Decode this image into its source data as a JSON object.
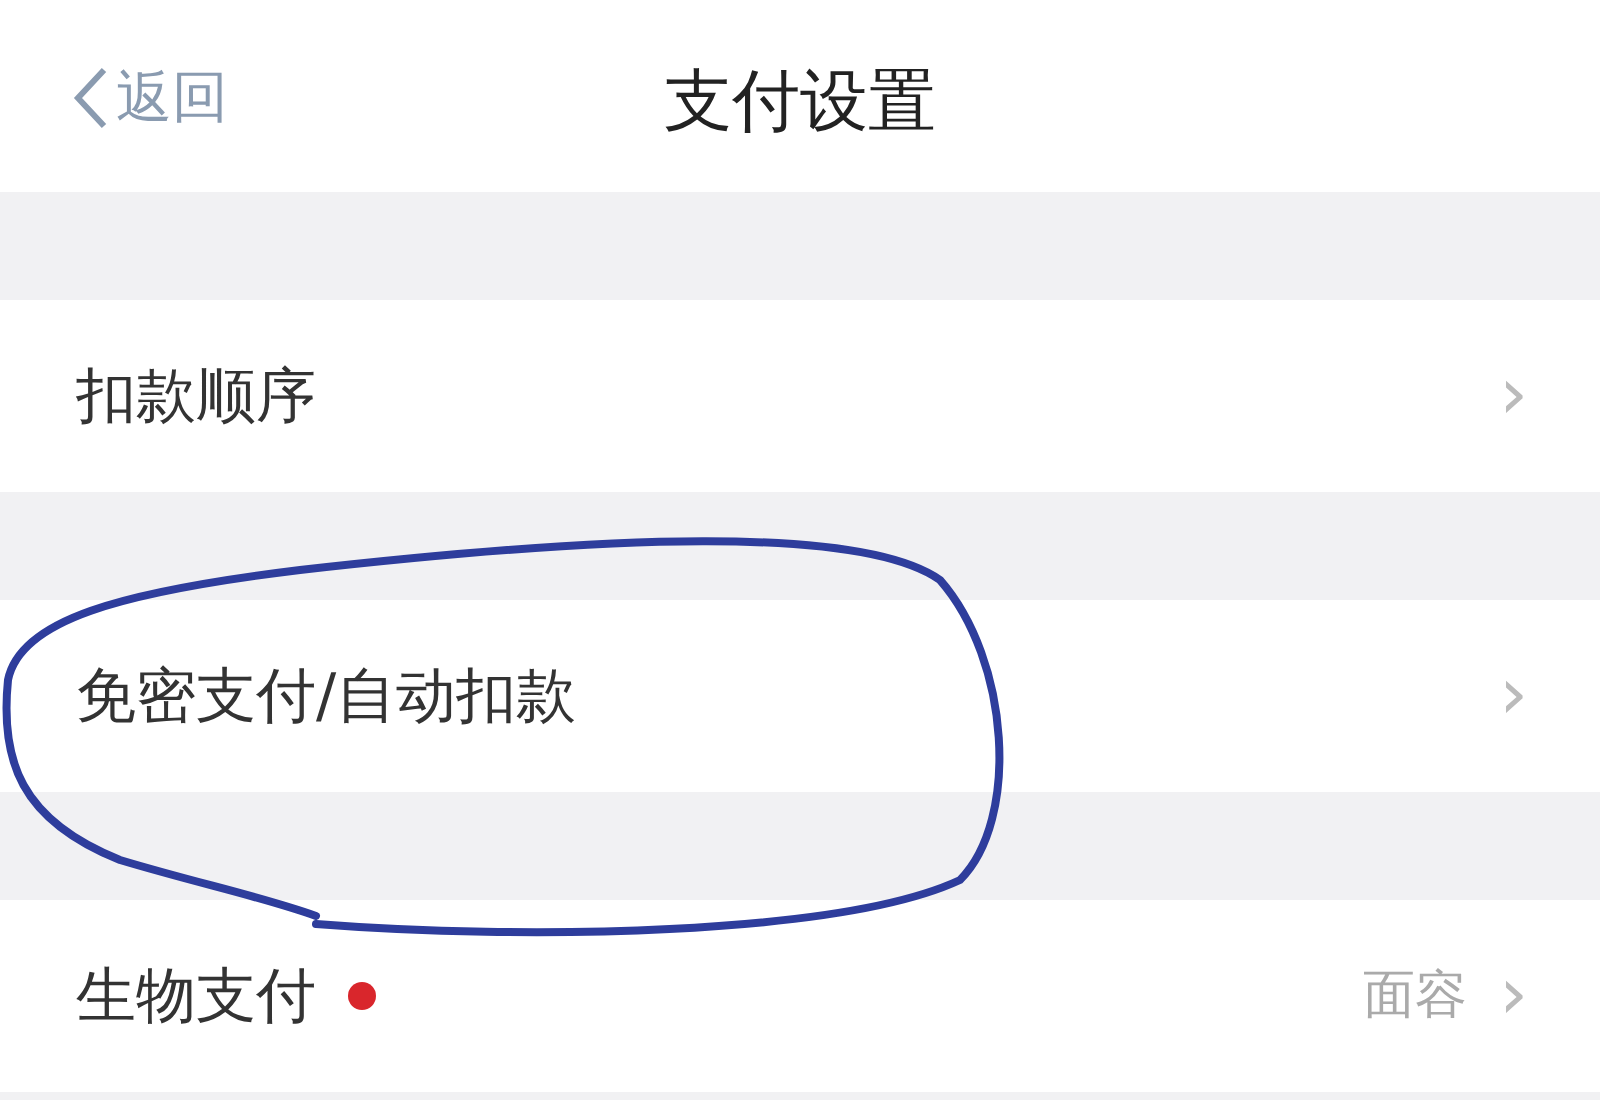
{
  "nav": {
    "back": "返回",
    "title": "支付设置"
  },
  "items": [
    {
      "label": "扣款顺序",
      "chevron": "›",
      "dot": false
    },
    {
      "label": "免密支付/自动扣款",
      "chevron": "›",
      "dot": false
    },
    {
      "label": "生物支付",
      "value": "面容",
      "chevron": "›",
      "dot": true
    }
  ]
}
